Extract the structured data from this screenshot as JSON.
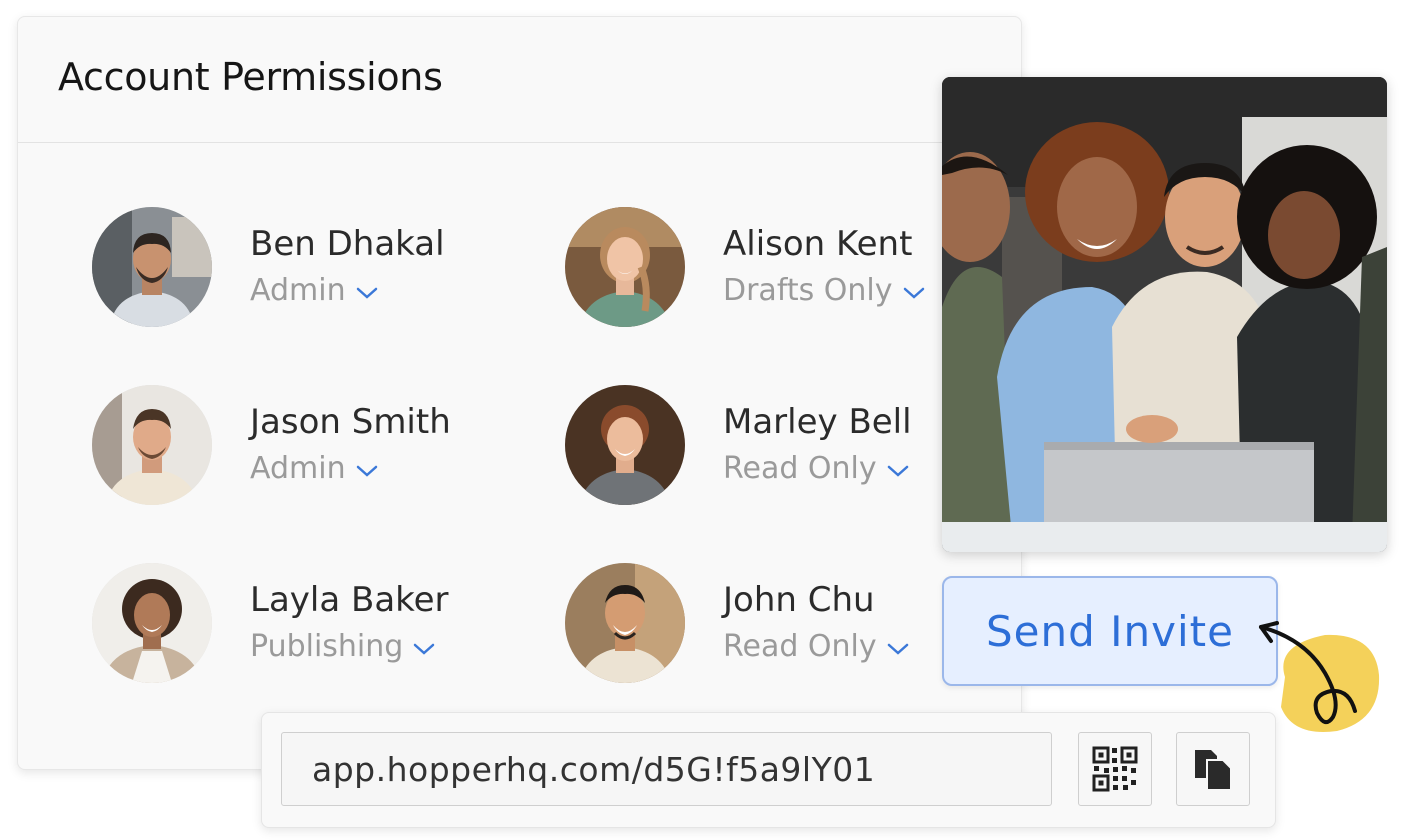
{
  "panel": {
    "title": "Account Permissions"
  },
  "members": [
    {
      "name": "Ben Dhakal",
      "role": "Admin"
    },
    {
      "name": "Jason Smith",
      "role": "Admin"
    },
    {
      "name": "Layla Baker",
      "role": "Publishing"
    },
    {
      "name": "Alison Kent",
      "role": "Drafts Only"
    },
    {
      "name": "Marley Bell",
      "role": "Read Only"
    },
    {
      "name": "John Chu",
      "role": "Read Only"
    }
  ],
  "invite": {
    "button_label": "Send Invite"
  },
  "share": {
    "link": "app.hopperhq.com/d5G!f5a9lY01",
    "qr_icon": "qr-code-icon",
    "copy_icon": "copy-icon"
  },
  "colors": {
    "accent": "#2d6ed7",
    "invite_bg": "#e6efff",
    "chevron": "#3b78d8",
    "doodle": "#f4d15a"
  }
}
